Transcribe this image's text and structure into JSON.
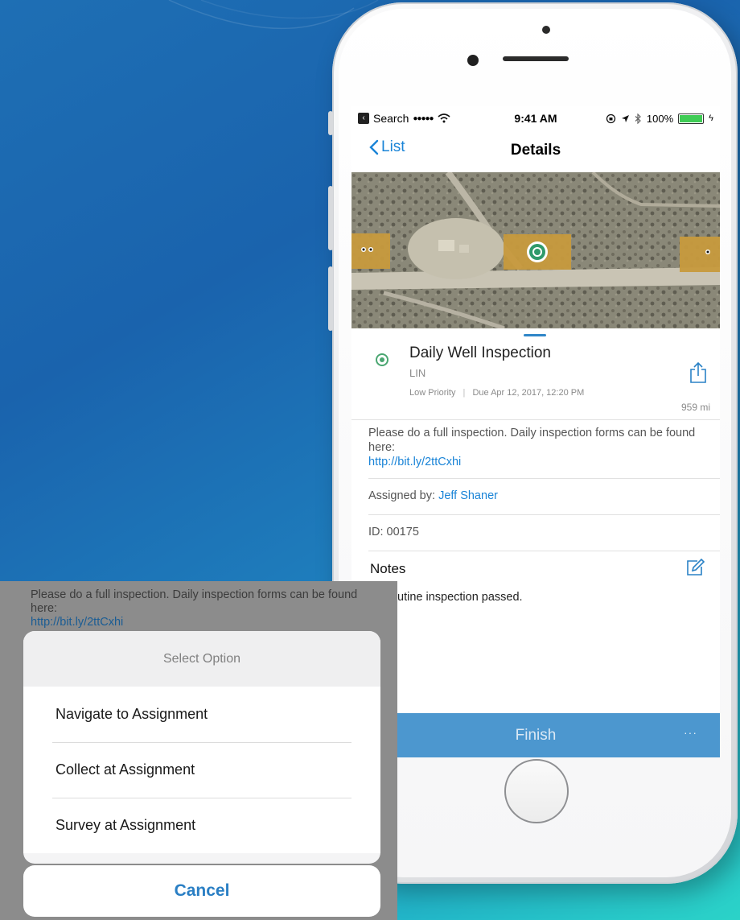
{
  "status_bar": {
    "back_app": "Search",
    "signal": "●●●●●",
    "time": "9:41 AM",
    "battery": "100%"
  },
  "nav": {
    "back_label": "List",
    "title": "Details"
  },
  "assignment": {
    "title": "Daily Well Inspection",
    "code": "LIN",
    "priority": "Low Priority",
    "due": "Due Apr 12, 2017, 12:20 PM",
    "distance": "959 mi",
    "description": "Please do a full inspection. Daily inspection forms can be found here:",
    "link": "http://bit.ly/2ttCxhi",
    "assigned_by_label": "Assigned by:",
    "assigned_by_name": "Jeff Shaner",
    "id_line": "ID: 00175",
    "notes_heading": "Notes",
    "notes_body": "Routine inspection passed.",
    "notes_body_visible": "utine inspection passed."
  },
  "footer": {
    "finish_label": "Finish",
    "more_label": "···"
  },
  "overlay": {
    "background_text": "Please do a full inspection. Daily inspection forms can be found here:",
    "background_link": "http://bit.ly/2ttCxhi",
    "action_sheet": {
      "title": "Select Option",
      "items": [
        "Navigate to Assignment",
        "Collect at Assignment",
        "Survey at Assignment"
      ],
      "cancel_label": "Cancel"
    }
  },
  "colors": {
    "accent": "#1a84d7",
    "finish_bar": "#4c97cf",
    "status_green": "#4aa671"
  }
}
